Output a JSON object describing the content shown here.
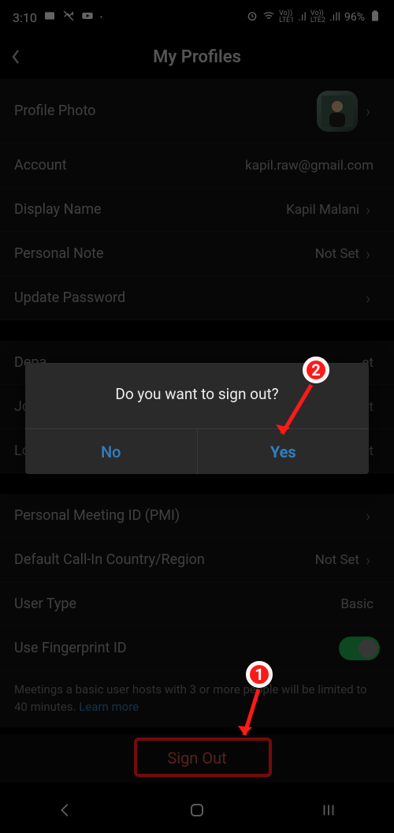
{
  "status": {
    "time": "3:10",
    "battery": "96%"
  },
  "header": {
    "title": "My Profiles"
  },
  "rows": {
    "profile_photo": "Profile Photo",
    "account_label": "Account",
    "account_value": "kapil.raw@gmail.com",
    "display_name_label": "Display Name",
    "display_name_value": "Kapil Malani",
    "personal_note_label": "Personal Note",
    "personal_note_value": "Not Set",
    "update_password": "Update Password",
    "department_label": "Depa",
    "department_value": "et",
    "job_label": "Job",
    "job_value": "et",
    "location_label": "Loca",
    "location_value": "et",
    "pmi": "Personal Meeting ID (PMI)",
    "callin_label": "Default Call-In Country/Region",
    "callin_value": "Not Set",
    "usertype_label": "User Type",
    "usertype_value": "Basic",
    "fingerprint": "Use Fingerprint ID",
    "note_text": "Meetings a basic user hosts with 3 or more people will be limited to 40 minutes. ",
    "learn_more": "Learn more",
    "sign_out": "Sign Out"
  },
  "dialog": {
    "message": "Do you want to sign out?",
    "no": "No",
    "yes": "Yes"
  },
  "annotations": {
    "step1": "1",
    "step2": "2"
  }
}
